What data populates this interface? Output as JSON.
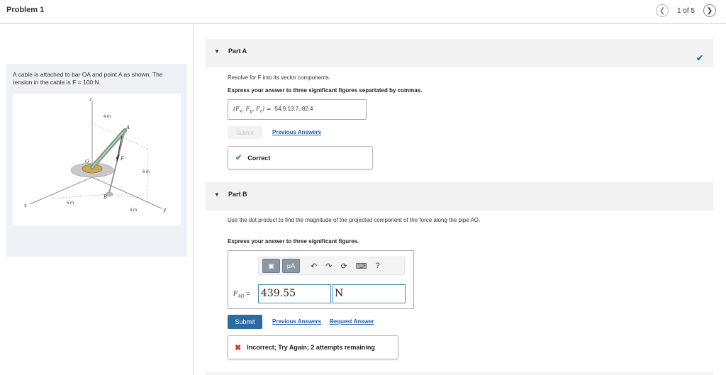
{
  "header": {
    "title": "Problem 1",
    "pager_text": "1 of 5",
    "prev_icon": "chevron-left-icon",
    "next_icon": "chevron-right-icon"
  },
  "problem": {
    "text": "A cable is attached to bar OA and point A as shown. The tension in the cable is F = 100 N.",
    "figure_labels": {
      "z": "z",
      "x": "x",
      "y": "y",
      "A": "A",
      "O": "O",
      "B": "B",
      "F": "F",
      "dim_4m_top": "4 m",
      "dim_6m": "6 m",
      "dim_5m": "5 m",
      "dim_4m_bottom": "4 m"
    }
  },
  "partA": {
    "label": "Part A",
    "instruction": "Resolve for F into its vector components.",
    "instruction_bold": "Express your answer to three significant figures separtated by commas.",
    "answer_label": "(Fx, Fy, Fz) =",
    "answer_value": "54.9,13.7,-82.4",
    "submit_label": "Submit",
    "previous_answers_label": "Previous Answers",
    "feedback": "Correct",
    "status_color": "#1a73c9"
  },
  "partB": {
    "label": "Part B",
    "instruction": "Use the dot product to find the magnitude of the projected component of the force along the pipe AO.",
    "instruction_bold": "Express your answer to three significant figures.",
    "toolbar": {
      "templates_icon": "templates-icon",
      "mu_label": "μA",
      "undo_icon": "undo-icon",
      "redo_icon": "redo-icon",
      "reset_icon": "reset-icon",
      "keyboard_icon": "keyboard-icon",
      "help_label": "?"
    },
    "variable_label": "FAO",
    "value": "439.55",
    "unit": "N",
    "submit_label": "Submit",
    "previous_answers_label": "Previous Answers",
    "request_answer_label": "Request Answer",
    "feedback": "Incorrect; Try Again; 2 attempts remaining",
    "submit_color": "#2b6aa3",
    "error_color": "#d8302a"
  }
}
